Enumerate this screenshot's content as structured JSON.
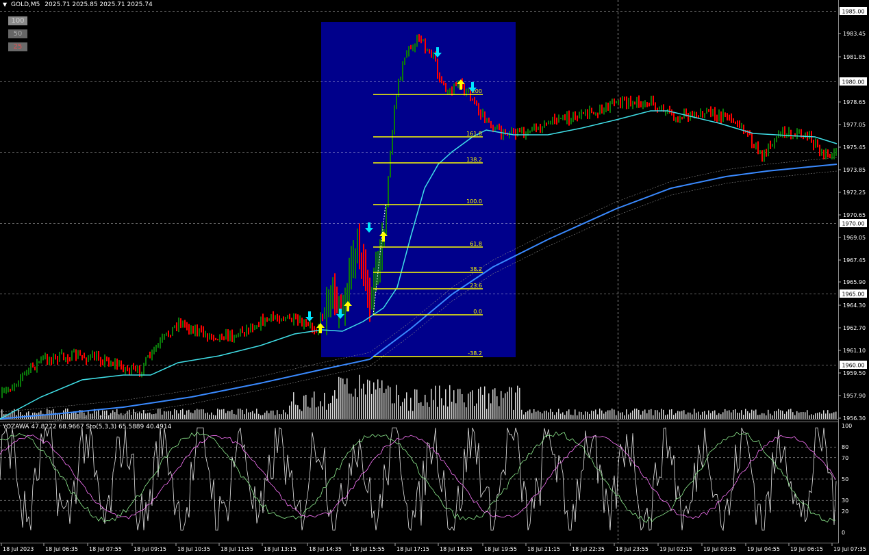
{
  "header": {
    "symbol_timeframe": "GOLD,M5",
    "ohlc": "2025.71 2025.85 2025.71 2025.74"
  },
  "scale_buttons": [
    "100",
    "50",
    "25"
  ],
  "price_axis": {
    "labels": [
      "1985.00",
      "1983.45",
      "1981.85",
      "1980.00",
      "1978.65",
      "1977.05",
      "1975.45",
      "1973.85",
      "1972.25",
      "1970.65",
      "1970.00",
      "1969.05",
      "1967.45",
      "1965.90",
      "1965.00",
      "1964.30",
      "1962.70",
      "1961.10",
      "1960.00",
      "1959.50",
      "1957.90",
      "1956.30"
    ],
    "boxed": [
      "1985.00",
      "1980.00",
      "1975.00",
      "1970.00",
      "1965.00",
      "1960.00"
    ],
    "current_price": "1975.00"
  },
  "time_axis": {
    "labels": [
      "18 Jul 2023",
      "18 Jul 06:35",
      "18 Jul 07:55",
      "18 Jul 09:15",
      "18 Jul 10:35",
      "18 Jul 11:55",
      "18 Jul 13:15",
      "18 Jul 14:35",
      "18 Jul 15:55",
      "18 Jul 17:15",
      "18 Jul 18:35",
      "18 Jul 19:55",
      "18 Jul 21:15",
      "18 Jul 22:35",
      "18 Jul 23:55",
      "19 Jul 02:15",
      "19 Jul 03:35",
      "19 Jul 04:55",
      "19 Jul 06:15",
      "19 Jul 07:35"
    ]
  },
  "fibonacci": {
    "levels": [
      "-38.2",
      "0.0",
      "23.6",
      "38.2",
      "61.8",
      "100.0",
      "138.2",
      "161.8",
      "200"
    ],
    "color": "#ffff00",
    "box_color": "#00008b"
  },
  "indicator": {
    "label": "YOZAWA 47.8272 68.9667  Sto(5,3,3) 65.5889 40.4914",
    "axis_labels": [
      "100",
      "80",
      "70",
      "50",
      "30",
      "20",
      "0"
    ]
  },
  "colors": {
    "bull": "#0a7a0a",
    "bear": "#ff0000",
    "ma_fast": "#40e0e8",
    "ma_slow": "#3a8aff",
    "grid": "#ffffff"
  }
}
